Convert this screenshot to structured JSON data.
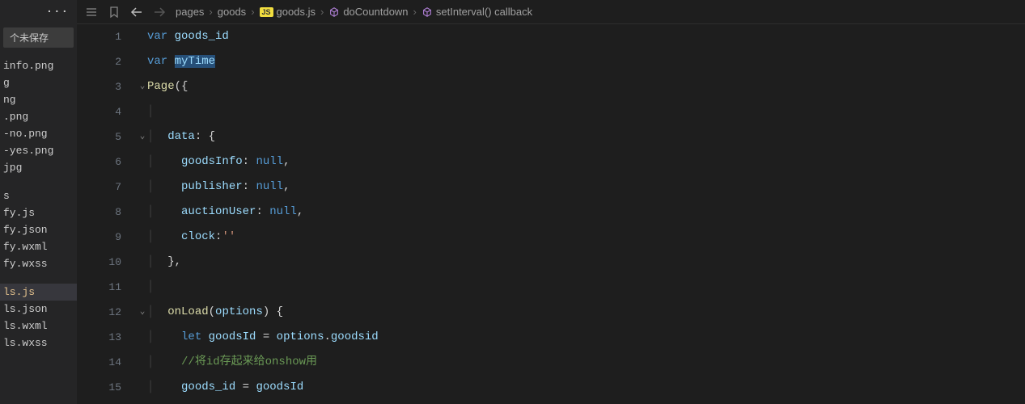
{
  "sidebar": {
    "ellipsis": "···",
    "unsaved": "个未保存",
    "files": [
      {
        "name": "info.png",
        "cls": ""
      },
      {
        "name": "g",
        "cls": ""
      },
      {
        "name": "ng",
        "cls": ""
      },
      {
        "name": ".png",
        "cls": ""
      },
      {
        "name": "-no.png",
        "cls": ""
      },
      {
        "name": "-yes.png",
        "cls": ""
      },
      {
        "name": "jpg",
        "cls": ""
      },
      {
        "name": "",
        "cls": "spacer"
      },
      {
        "name": "s",
        "cls": ""
      },
      {
        "name": "fy.js",
        "cls": ""
      },
      {
        "name": "fy.json",
        "cls": ""
      },
      {
        "name": "fy.wxml",
        "cls": ""
      },
      {
        "name": "fy.wxss",
        "cls": ""
      },
      {
        "name": "",
        "cls": "spacer"
      },
      {
        "name": "ls.js",
        "cls": "active modified"
      },
      {
        "name": "ls.json",
        "cls": ""
      },
      {
        "name": "ls.wxml",
        "cls": ""
      },
      {
        "name": "ls.wxss",
        "cls": ""
      }
    ]
  },
  "breadcrumb": {
    "items": [
      "pages",
      "goods",
      "goods.js",
      "doCountdown",
      "setInterval() callback"
    ],
    "sep": "›"
  },
  "code": {
    "lines": [
      {
        "n": "1",
        "fold": "",
        "html": "<span class='k-blue'>var</span> <span class='k-var'>goods_id</span>"
      },
      {
        "n": "2",
        "fold": "",
        "html": "<span class='k-blue'>var</span> <span class='k-var k-sel'>myTime</span>"
      },
      {
        "n": "3",
        "fold": "⌄",
        "html": "<span class='k-func'>Page</span><span class='k-punc'>({</span>"
      },
      {
        "n": "4",
        "fold": "",
        "html": "<span class='indent-guide'>│</span>"
      },
      {
        "n": "5",
        "fold": "⌄",
        "html": "<span class='indent-guide'>│</span>  <span class='k-var'>data</span><span class='k-punc'>: {</span>"
      },
      {
        "n": "6",
        "fold": "",
        "html": "<span class='indent-guide'>│</span>    <span class='k-var'>goodsInfo</span><span class='k-punc'>:</span> <span class='k-const'>null</span><span class='k-punc'>,</span>"
      },
      {
        "n": "7",
        "fold": "",
        "html": "<span class='indent-guide'>│</span>    <span class='k-var'>publisher</span><span class='k-punc'>:</span> <span class='k-const'>null</span><span class='k-punc'>,</span>"
      },
      {
        "n": "8",
        "fold": "",
        "html": "<span class='indent-guide'>│</span>    <span class='k-var'>auctionUser</span><span class='k-punc'>:</span> <span class='k-const'>null</span><span class='k-punc'>,</span>"
      },
      {
        "n": "9",
        "fold": "",
        "html": "<span class='indent-guide'>│</span>    <span class='k-var'>clock</span><span class='k-punc'>:</span><span class='k-str'>''</span>"
      },
      {
        "n": "10",
        "fold": "",
        "html": "<span class='indent-guide'>│</span>  <span class='k-punc'>},</span>"
      },
      {
        "n": "11",
        "fold": "",
        "html": "<span class='indent-guide'>│</span>"
      },
      {
        "n": "12",
        "fold": "⌄",
        "html": "<span class='indent-guide'>│</span>  <span class='k-func'>onLoad</span><span class='k-punc'>(</span><span class='k-var'>options</span><span class='k-punc'>) {</span>"
      },
      {
        "n": "13",
        "fold": "",
        "html": "<span class='indent-guide'>│</span>    <span class='k-blue'>let</span> <span class='k-var'>goodsId</span> <span class='k-punc'>=</span> <span class='k-var'>options</span><span class='k-punc'>.</span><span class='k-var'>goodsid</span>"
      },
      {
        "n": "14",
        "fold": "",
        "html": "<span class='indent-guide'>│</span>    <span class='k-comment'>//将id存起来给onshow用</span>"
      },
      {
        "n": "15",
        "fold": "",
        "html": "<span class='indent-guide'>│</span>    <span class='k-var'>goods_id</span> <span class='k-punc'>=</span> <span class='k-var'>goodsId</span>"
      }
    ]
  }
}
